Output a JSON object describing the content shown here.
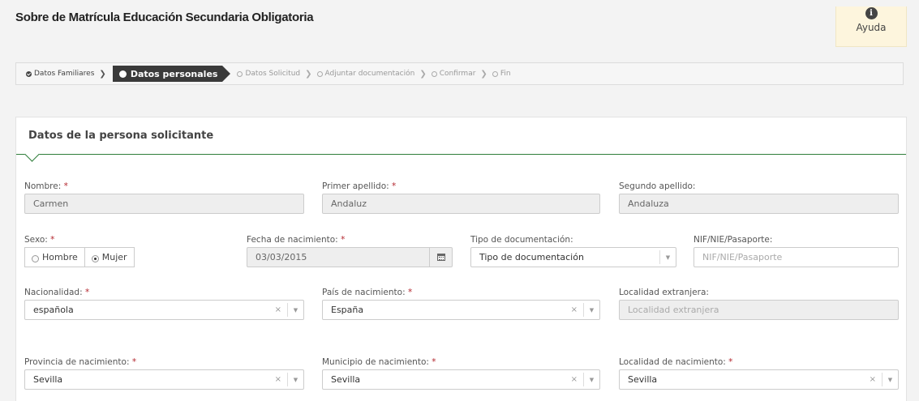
{
  "page": {
    "title": "Sobre de Matrícula Educación Secundaria Obligatoria"
  },
  "help": {
    "label": "Ayuda",
    "icon": "info-icon"
  },
  "steps": [
    {
      "label": "Datos Familiares",
      "state": "done"
    },
    {
      "label": "Datos personales",
      "state": "active"
    },
    {
      "label": "Datos Solicitud",
      "state": "todo"
    },
    {
      "label": "Adjuntar documentación",
      "state": "todo"
    },
    {
      "label": "Confirmar",
      "state": "todo"
    },
    {
      "label": "Fin",
      "state": "todo"
    }
  ],
  "panel": {
    "title": "Datos de la persona solicitante"
  },
  "form": {
    "required_mark": "*",
    "nombre": {
      "label": "Nombre:",
      "value": "Carmen"
    },
    "primer_apellido": {
      "label": "Primer apellido:",
      "value": "Andaluz"
    },
    "segundo_apellido": {
      "label": "Segundo apellido:",
      "value": "Andaluza"
    },
    "sexo": {
      "label": "Sexo:",
      "options": [
        "Hombre",
        "Mujer"
      ],
      "selected": "Mujer"
    },
    "fecha_nacimiento": {
      "label": "Fecha de nacimiento:",
      "value": "03/03/2015"
    },
    "tipo_documentacion": {
      "label": "Tipo de documentación:",
      "value": "Tipo de documentación"
    },
    "nif": {
      "label": "NIF/NIE/Pasaporte:",
      "placeholder": "NIF/NIE/Pasaporte"
    },
    "nacionalidad": {
      "label": "Nacionalidad:",
      "value": "española"
    },
    "pais_nacimiento": {
      "label": "País de nacimiento:",
      "value": "España"
    },
    "localidad_extranjera": {
      "label": "Localidad extranjera:",
      "placeholder": "Localidad extranjera"
    },
    "provincia_nacimiento": {
      "label": "Provincia de nacimiento:",
      "value": "Sevilla"
    },
    "municipio_nacimiento": {
      "label": "Municipio de nacimiento:",
      "value": "Sevilla"
    },
    "localidad_nacimiento": {
      "label": "Localidad de nacimiento:",
      "value": "Sevilla"
    }
  },
  "icons": {
    "clear": "×",
    "dropdown": "▼"
  }
}
